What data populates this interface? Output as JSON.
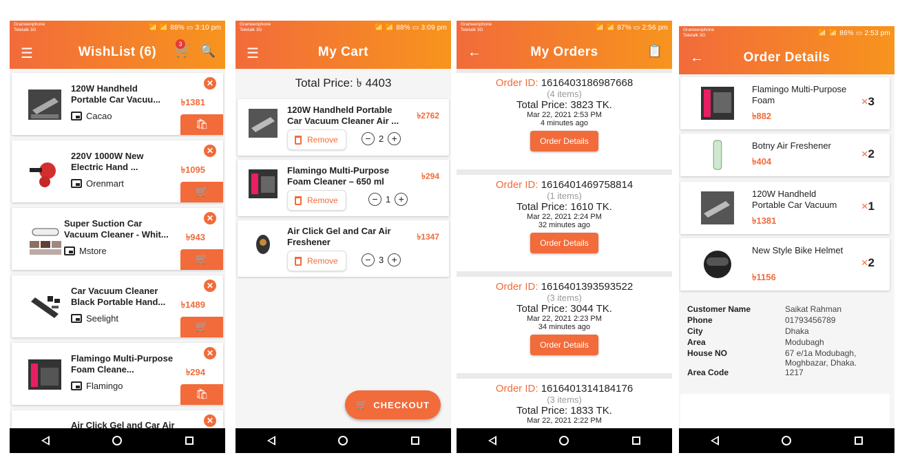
{
  "wishlist": {
    "status": {
      "carrier1": "Grameenphone",
      "carrier2": "Teletalk 3G",
      "right": "📶 📶 88% ▭ 3:10 pm"
    },
    "title": "WishList (6)",
    "cart_count": "3",
    "items": [
      {
        "name": "120W Handheld Portable Car Vacuu...",
        "price": "৳1381",
        "store": "Cacao",
        "action": "bag"
      },
      {
        "name": "220V 1000W New Electric Hand ...",
        "price": "৳1095",
        "store": "Orenmart",
        "action": "cart"
      },
      {
        "name": "Super Suction Car Vacuum Cleaner - Whit...",
        "price": "৳943",
        "store": "Mstore",
        "action": "cart"
      },
      {
        "name": "Car Vacuum Cleaner Black Portable Hand...",
        "price": "৳1489",
        "store": "Seelight",
        "action": "cart"
      },
      {
        "name": "Flamingo Multi-Purpose Foam Cleane...",
        "price": "৳294",
        "store": "Flamingo",
        "action": "bag"
      },
      {
        "name": "Air Click Gel and Car Air",
        "price": "",
        "store": "",
        "action": ""
      }
    ]
  },
  "cart": {
    "status": {
      "carrier1": "Grameenphone",
      "carrier2": "Teletalk 3G",
      "right": "📶 📶 88% ▭ 3:09 pm"
    },
    "title": "My Cart",
    "total": "Total Price: ৳ 4403",
    "items": [
      {
        "name": "120W Handheld Portable Car Vacuum Cleaner Air ...",
        "price": "৳2762",
        "qty": "2"
      },
      {
        "name": "Flamingo Multi-Purpose Foam Cleaner – 650 ml",
        "price": "৳294",
        "qty": "1"
      },
      {
        "name": "Air Click Gel and Car Air Freshener",
        "price": "৳1347",
        "qty": "3"
      }
    ],
    "remove_label": "Remove",
    "checkout_label": "CHECKOUT"
  },
  "orders": {
    "status": {
      "carrier1": "Grameenphone",
      "carrier2": "Teletalk 3G",
      "right": "📶 📶 87% ▭ 2:56 pm"
    },
    "title": "My Orders",
    "id_label": "Order ID:",
    "button_label": "Order Details",
    "list": [
      {
        "id": "1616403186987668",
        "items": "(4 items)",
        "total": "Total Price: 3823 TK.",
        "date": "Mar 22, 2021 2:53 PM",
        "ago": "4 minutes ago"
      },
      {
        "id": "1616401469758814",
        "items": "(1 items)",
        "total": "Total Price: 1610 TK.",
        "date": "Mar 22, 2021 2:24 PM",
        "ago": "32 minutes ago"
      },
      {
        "id": "1616401393593522",
        "items": "(3 items)",
        "total": "Total Price: 3044 TK.",
        "date": "Mar 22, 2021 2:23 PM",
        "ago": "34 minutes ago"
      },
      {
        "id": "1616401314184176",
        "items": "(3 items)",
        "total": "Total Price: 1833 TK.",
        "date": "Mar 22, 2021 2:22 PM",
        "ago": ""
      }
    ]
  },
  "details": {
    "status": {
      "carrier1": "Grameenphone",
      "carrier2": "Teletalk 3G",
      "right": "📶 📶 86% ▭ 2:53 pm"
    },
    "title": "Order Details",
    "items": [
      {
        "name": "Flamingo Multi-Purpose Foam",
        "price": "৳882",
        "qty": "3"
      },
      {
        "name": "Botny Air Freshener",
        "price": "৳404",
        "qty": "2"
      },
      {
        "name": "120W Handheld Portable Car Vacuum",
        "price": "৳1381",
        "qty": "1"
      },
      {
        "name": "New Style Bike Helmet",
        "price": "৳1156",
        "qty": "2"
      }
    ],
    "customer": {
      "name_label": "Customer Name",
      "name": "Saikat Rahman",
      "phone_label": "Phone",
      "phone": "01793456789",
      "city_label": "City",
      "city": "Dhaka",
      "area_label": "Area",
      "area": "Modubagh",
      "house_label": "House NO",
      "house": "67 e/1a  Modubagh, Moghbazar, Dhaka.",
      "code_label": "Area Code",
      "code": "1217"
    }
  },
  "colors": {
    "accent": "#f26b3a",
    "accent2": "#f7941d",
    "price": "#f26b3a"
  }
}
